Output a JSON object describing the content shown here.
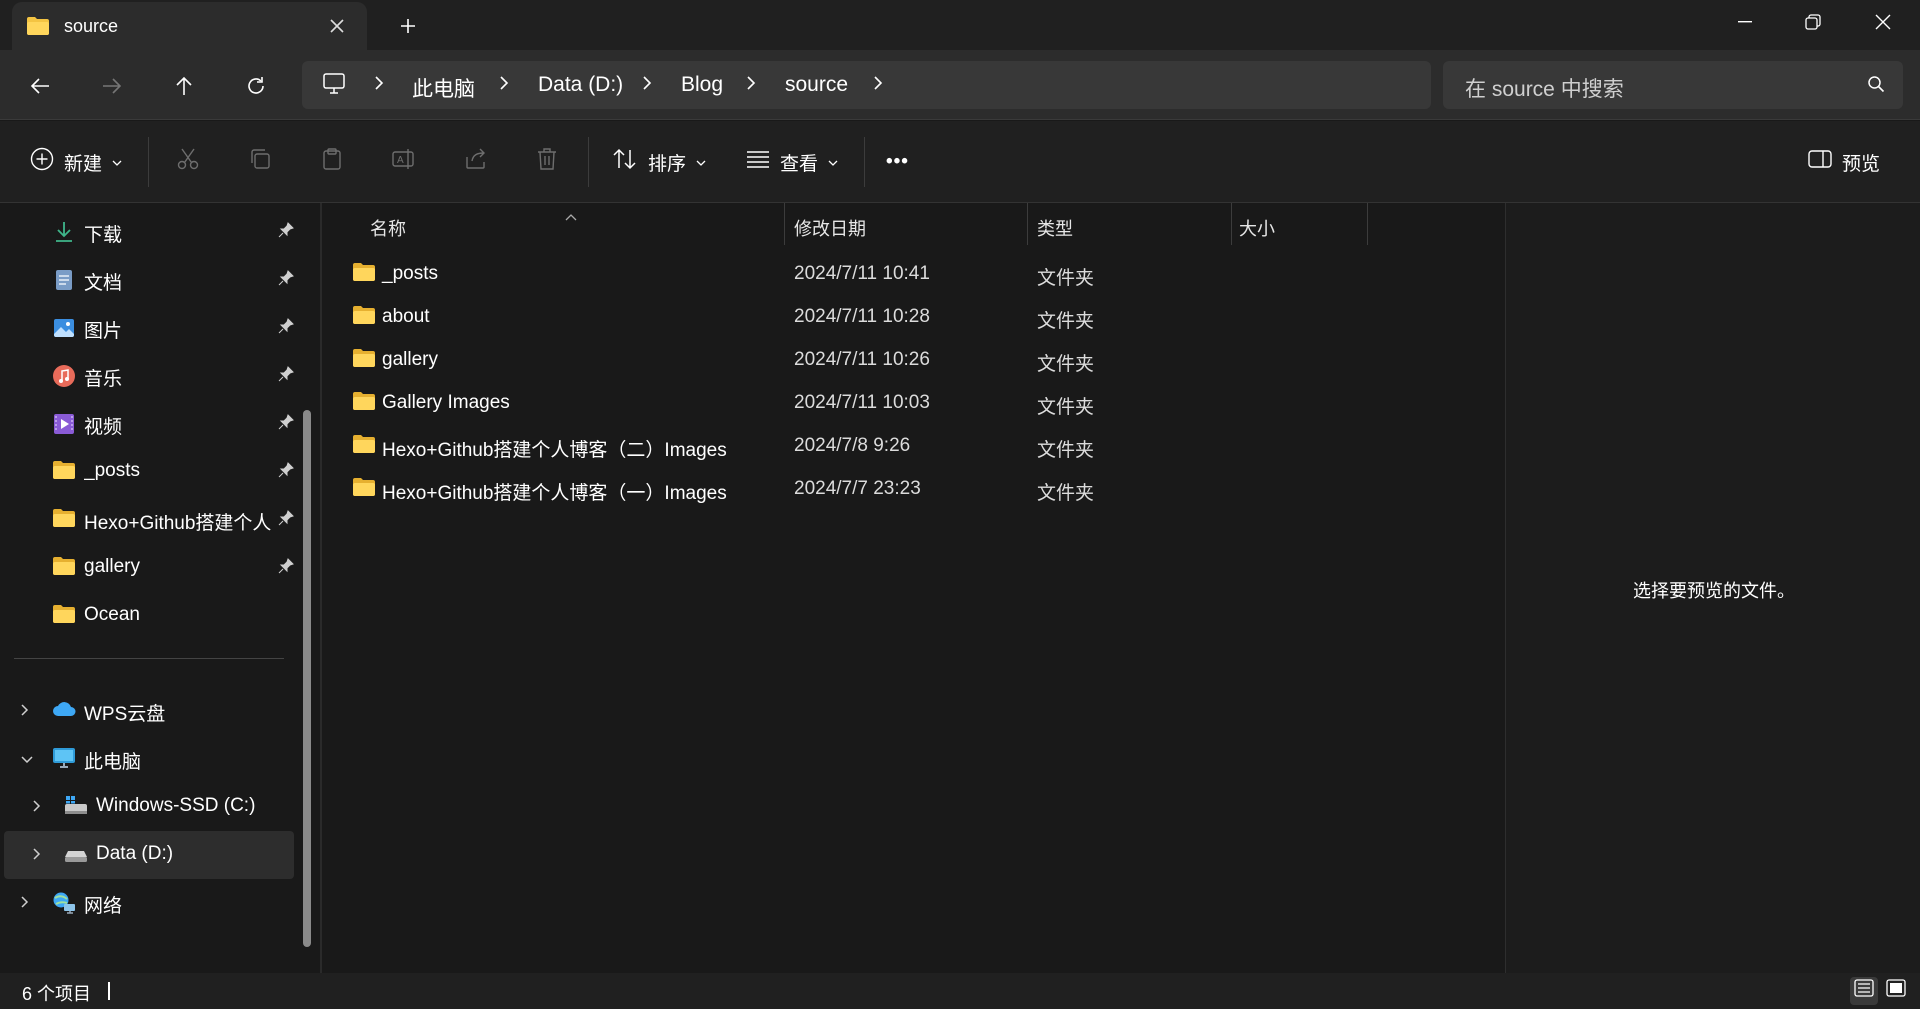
{
  "window": {
    "tab_title": "source",
    "new_tab": "+"
  },
  "address": {
    "crumbs": [
      "此电脑",
      "Data (D:)",
      "Blog",
      "source"
    ],
    "search_placeholder": "在 source 中搜索"
  },
  "toolbar": {
    "new_label": "新建",
    "sort_label": "排序",
    "view_label": "查看",
    "more_label": "•••",
    "preview_label": "预览"
  },
  "sidebar": {
    "quick_access": [
      {
        "label": "下载",
        "icon": "download-icon",
        "pinned": true
      },
      {
        "label": "文档",
        "icon": "document-icon",
        "pinned": true
      },
      {
        "label": "图片",
        "icon": "pictures-icon",
        "pinned": true
      },
      {
        "label": "音乐",
        "icon": "music-icon",
        "pinned": true
      },
      {
        "label": "视频",
        "icon": "video-icon",
        "pinned": true
      },
      {
        "label": "_posts",
        "icon": "folder-icon",
        "pinned": true
      },
      {
        "label": "Hexo+Github搭建个人博客（二）Images",
        "icon": "folder-icon",
        "pinned": true
      },
      {
        "label": "gallery",
        "icon": "folder-icon",
        "pinned": true
      },
      {
        "label": "Ocean",
        "icon": "folder-icon",
        "pinned": false
      }
    ],
    "tree": [
      {
        "label": "WPS云盘",
        "icon": "cloud-icon",
        "expanded": false
      },
      {
        "label": "此电脑",
        "icon": "computer-icon",
        "expanded": true
      },
      {
        "label": "Windows-SSD (C:)",
        "icon": "windows-drive-icon",
        "expanded": false
      },
      {
        "label": "Data (D:)",
        "icon": "drive-icon",
        "expanded": false,
        "selected": true
      },
      {
        "label": "网络",
        "icon": "network-icon",
        "expanded": false
      }
    ]
  },
  "filelist": {
    "columns": [
      "名称",
      "修改日期",
      "类型",
      "大小"
    ],
    "rows": [
      {
        "name": "_posts",
        "date": "2024/7/11 10:41",
        "type": "文件夹",
        "size": ""
      },
      {
        "name": "about",
        "date": "2024/7/11 10:28",
        "type": "文件夹",
        "size": ""
      },
      {
        "name": "gallery",
        "date": "2024/7/11 10:26",
        "type": "文件夹",
        "size": ""
      },
      {
        "name": "Gallery Images",
        "date": "2024/7/11 10:03",
        "type": "文件夹",
        "size": ""
      },
      {
        "name": "Hexo+Github搭建个人博客（二）Images",
        "date": "2024/7/8 9:26",
        "type": "文件夹",
        "size": ""
      },
      {
        "name": "Hexo+Github搭建个人博客（一）Images",
        "date": "2024/7/7 23:23",
        "type": "文件夹",
        "size": ""
      }
    ]
  },
  "preview": {
    "message": "选择要预览的文件。"
  },
  "status": {
    "item_count": "6 个项目"
  },
  "colors": {
    "folder": "#f4c443",
    "background": "#191919",
    "toolbar": "#202020",
    "address": "#2c2c2c"
  }
}
